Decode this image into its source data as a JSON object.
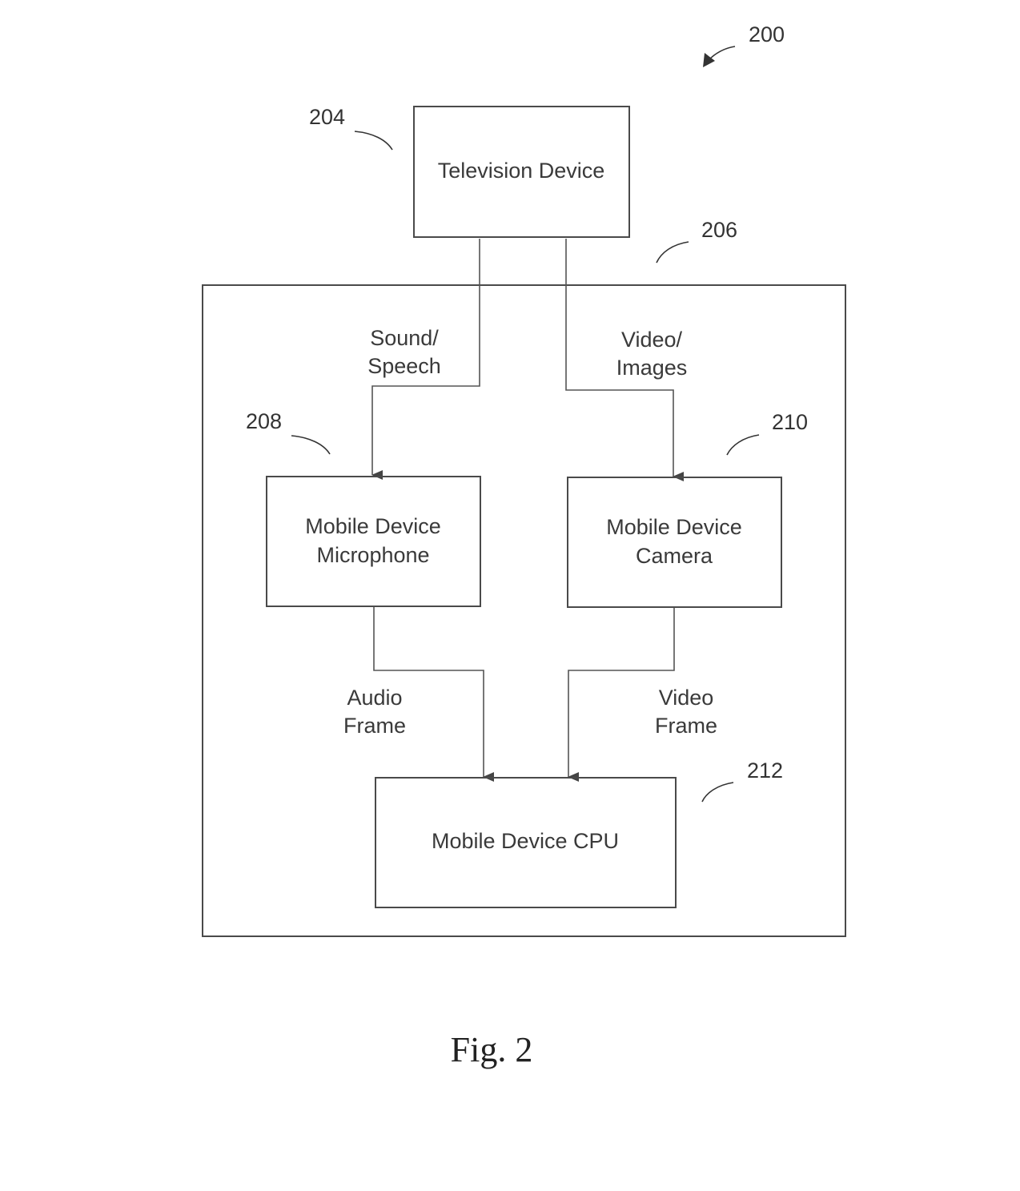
{
  "figure": {
    "reference": "200",
    "caption": "Fig. 2"
  },
  "blocks": {
    "television": {
      "ref": "204",
      "line1": "Television Device"
    },
    "mobile_device": {
      "ref": "206"
    },
    "microphone": {
      "ref": "208",
      "line1": "Mobile Device",
      "line2": "Microphone"
    },
    "camera": {
      "ref": "210",
      "line1": "Mobile Device",
      "line2": "Camera"
    },
    "cpu": {
      "ref": "212",
      "line1": "Mobile Device CPU"
    }
  },
  "signals": {
    "sound": {
      "line1": "Sound/",
      "line2": "Speech"
    },
    "video_images": {
      "line1": "Video/",
      "line2": "Images"
    },
    "audio_frame": {
      "line1": "Audio",
      "line2": "Frame"
    },
    "video_frame": {
      "line1": "Video",
      "line2": "Frame"
    }
  }
}
